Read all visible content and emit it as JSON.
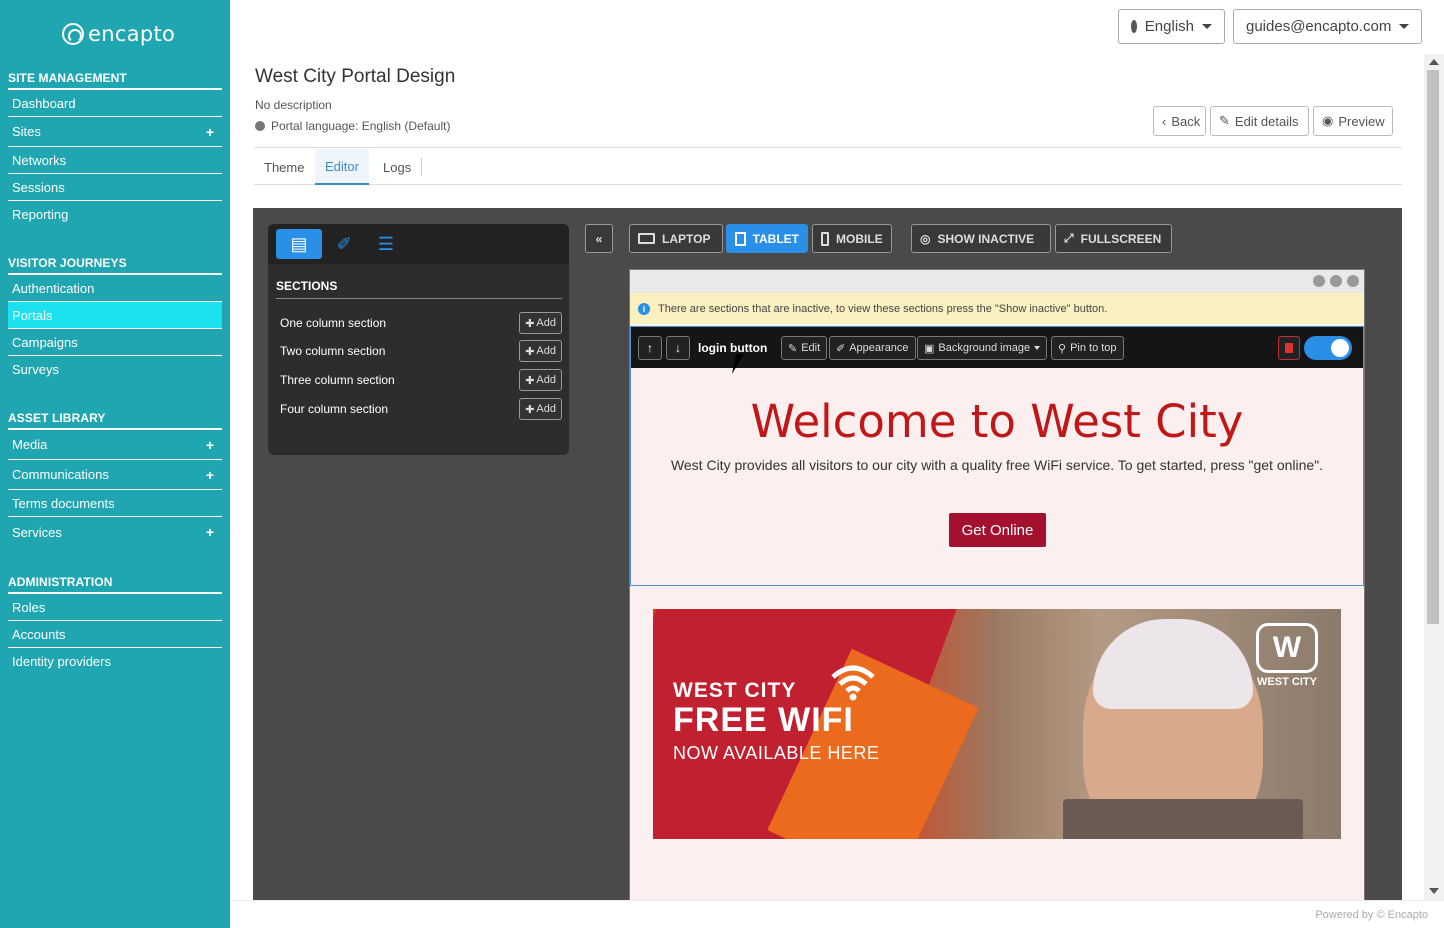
{
  "brand": {
    "logo_text": "encapto"
  },
  "sidebar": {
    "sections": [
      {
        "heading": "SITE MANAGEMENT",
        "items": [
          {
            "label": "Dashboard",
            "plus": false
          },
          {
            "label": "Sites",
            "plus": true
          },
          {
            "label": "Networks",
            "plus": false
          },
          {
            "label": "Sessions",
            "plus": false
          },
          {
            "label": "Reporting",
            "plus": false
          }
        ]
      },
      {
        "heading": "VISITOR JOURNEYS",
        "items": [
          {
            "label": "Authentication",
            "plus": false
          },
          {
            "label": "Portals",
            "plus": false,
            "active": true
          },
          {
            "label": "Campaigns",
            "plus": false
          },
          {
            "label": "Surveys",
            "plus": false
          }
        ]
      },
      {
        "heading": "ASSET LIBRARY",
        "items": [
          {
            "label": "Media",
            "plus": true
          },
          {
            "label": "Communications",
            "plus": true
          },
          {
            "label": "Terms documents",
            "plus": false
          },
          {
            "label": "Services",
            "plus": true
          }
        ]
      },
      {
        "heading": "ADMINISTRATION",
        "items": [
          {
            "label": "Roles",
            "plus": false
          },
          {
            "label": "Accounts",
            "plus": false
          },
          {
            "label": "Identity providers",
            "plus": false
          }
        ]
      }
    ],
    "plus_symbol": "+"
  },
  "topbar": {
    "language": "English",
    "user": "guides@encapto.com"
  },
  "header": {
    "title": "West City Portal Design",
    "description": "No description",
    "language": "Portal language: English (Default)",
    "back": "Back",
    "edit_details": "Edit details",
    "preview": "Preview"
  },
  "tabs": [
    {
      "label": "Theme"
    },
    {
      "label": "Editor",
      "active": true
    },
    {
      "label": "Logs"
    }
  ],
  "editor": {
    "sections_heading": "SECTIONS",
    "sections": [
      {
        "label": "One column section",
        "add": "Add"
      },
      {
        "label": "Two column section",
        "add": "Add"
      },
      {
        "label": "Three column section",
        "add": "Add"
      },
      {
        "label": "Four column section",
        "add": "Add"
      }
    ],
    "laptop": "LAPTOP",
    "tablet": "TABLET",
    "mobile": "MOBILE",
    "show_inactive": "SHOW INACTIVE",
    "fullscreen": "FULLSCREEN",
    "notice": "There are sections that are inactive, to view these sections press the \"Show inactive\" button.",
    "section_label": "login button",
    "tool_edit": "Edit",
    "tool_appearance": "Appearance",
    "tool_background": "Background image",
    "tool_pin": "Pin to top",
    "accent": "#2a8fe6"
  },
  "portal": {
    "title": "Welcome to West City",
    "text": "West City provides all visitors to our city with a quality free WiFi service. To get started, press \"get online\".",
    "button": "Get Online",
    "title_color": "#c01818",
    "button_color": "#a3112e",
    "banner": {
      "line1": "WEST CITY",
      "line2": "FREE WIFI",
      "line3": "NOW AVAILABLE HERE",
      "logo_text": "WEST CITY"
    }
  },
  "footer": {
    "powered": "Powered by © Encapto"
  }
}
